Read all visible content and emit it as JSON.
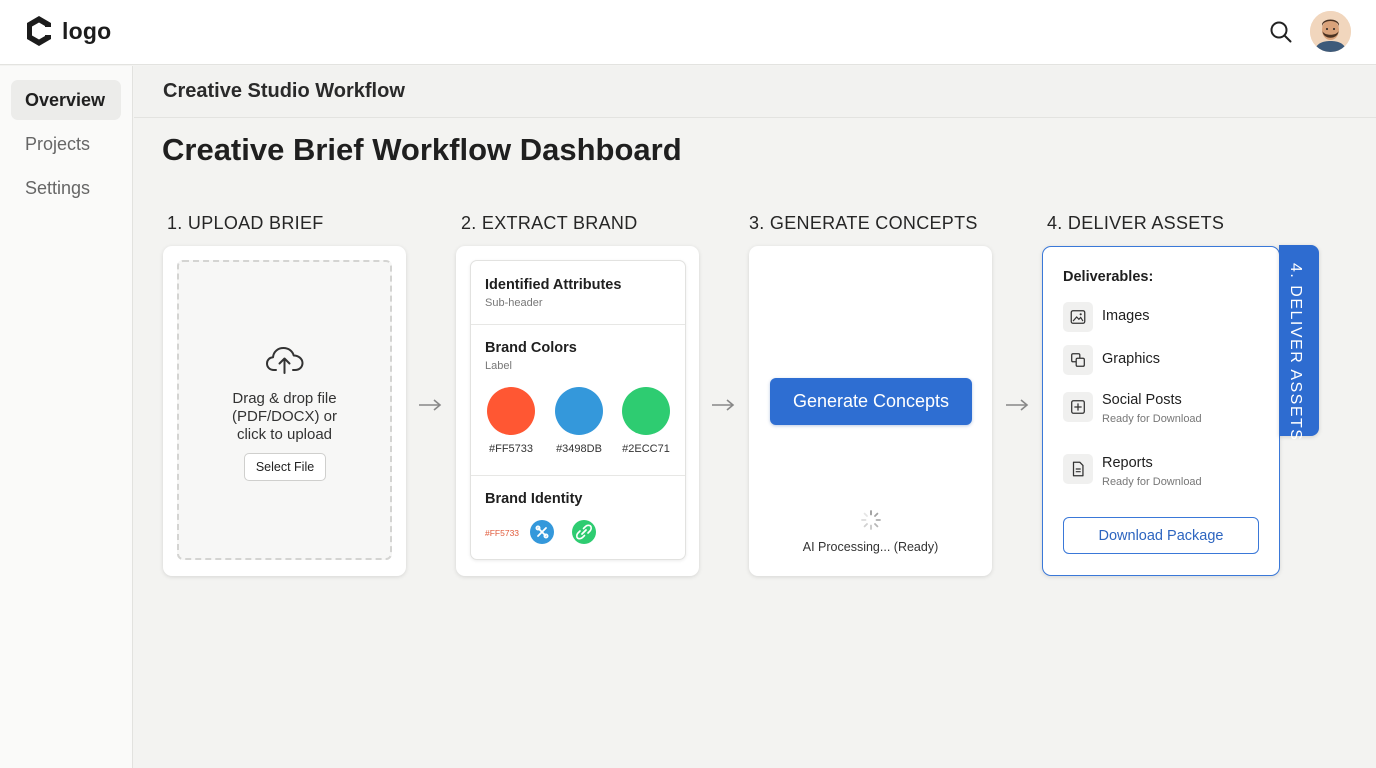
{
  "header": {
    "logo_text": "logo",
    "search_icon": "search-icon",
    "avatar": "user-avatar"
  },
  "sidebar": {
    "items": [
      {
        "label": "Overview",
        "active": true
      },
      {
        "label": "Projects",
        "active": false
      },
      {
        "label": "Settings",
        "active": false
      }
    ]
  },
  "subheader": {
    "title": "Creative Studio Workflow"
  },
  "page": {
    "title": "Creative Brief Workflow Dashboard"
  },
  "steps": [
    {
      "label": "1. UPLOAD BRIEF"
    },
    {
      "label": "2. EXTRACT BRAND"
    },
    {
      "label": "3. GENERATE CONCEPTS"
    },
    {
      "label": "4. DELIVER ASSETS"
    }
  ],
  "upload": {
    "line1": "Drag & drop file",
    "line2": "(PDF/DOCX) or",
    "line3": "click to upload",
    "button": "Select File",
    "icon": "cloud-upload-icon"
  },
  "extract": {
    "attributes_title": "Identified Attributes",
    "attributes_sub": "Sub-header",
    "colors_title": "Brand Colors",
    "colors_sub": "Label",
    "colors": [
      {
        "hex": "#FF5733",
        "label": "#FF5733"
      },
      {
        "hex": "#3498DB",
        "label": "#3498DB"
      },
      {
        "hex": "#2ECC71",
        "label": "#2ECC71"
      }
    ],
    "identity_title": "Brand Identity",
    "identity_hex": "#FF5733",
    "identity_icons": [
      "tools-icon",
      "link-icon"
    ]
  },
  "generate": {
    "button": "Generate Concepts",
    "status": "AI Processing... (Ready)"
  },
  "deliver": {
    "title": "Deliverables:",
    "items": [
      {
        "label": "Images",
        "status": "",
        "icon": "image-icon"
      },
      {
        "label": "Graphics",
        "status": "",
        "icon": "layers-icon"
      },
      {
        "label": "Social Posts",
        "status": "Ready for Download",
        "icon": "share-plus-icon"
      },
      {
        "label": "Reports",
        "status": "Ready for Download",
        "icon": "document-icon"
      }
    ],
    "button": "Download Package",
    "tab_label": "4. DELIVER ASSETS"
  },
  "colors": {
    "accent": "#2E6ED2",
    "orange": "#FF5733",
    "blue": "#3498DB",
    "green": "#2ECC71"
  }
}
